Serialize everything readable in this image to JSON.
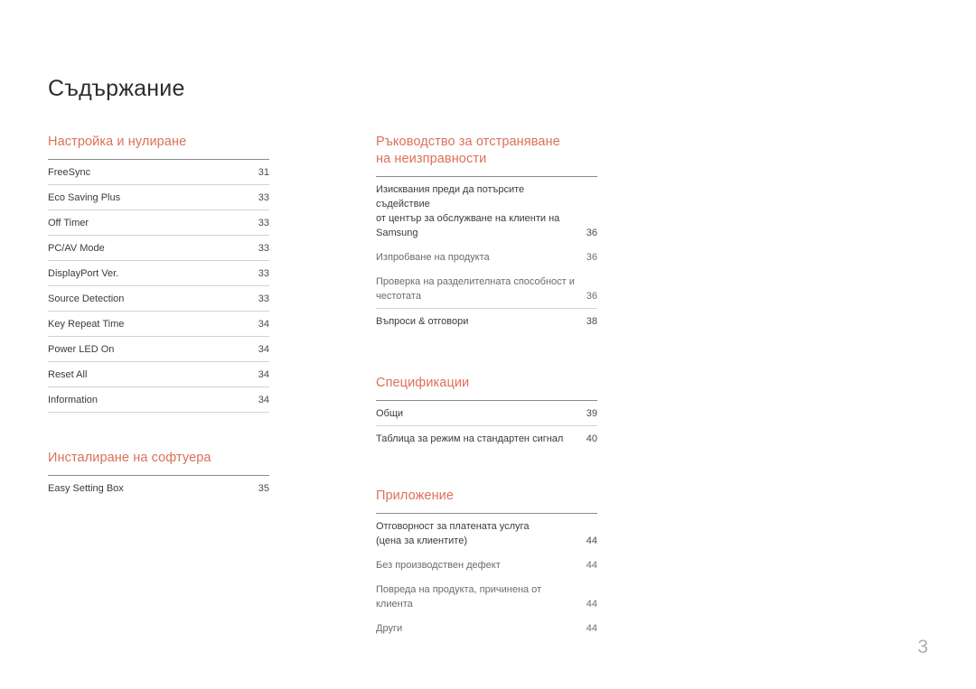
{
  "document": {
    "title": "Съдържание",
    "page_number": "3",
    "accent_color": "#dd7058"
  },
  "left_column": [
    {
      "heading": "Настройка и нулиране",
      "entries": [
        {
          "lines": [
            "FreeSync"
          ],
          "page": "31"
        },
        {
          "lines": [
            "Eco Saving Plus"
          ],
          "page": "33"
        },
        {
          "lines": [
            "Off Timer"
          ],
          "page": "33"
        },
        {
          "lines": [
            "PC/AV Mode"
          ],
          "page": "33"
        },
        {
          "lines": [
            "DisplayPort Ver."
          ],
          "page": "33"
        },
        {
          "lines": [
            "Source Detection"
          ],
          "page": "33"
        },
        {
          "lines": [
            "Key Repeat Time"
          ],
          "page": "34"
        },
        {
          "lines": [
            "Power LED On"
          ],
          "page": "34"
        },
        {
          "lines": [
            "Reset All"
          ],
          "page": "34"
        },
        {
          "lines": [
            "Information"
          ],
          "page": "34"
        }
      ]
    },
    {
      "heading": "Инсталиране на софтуера",
      "entries": [
        {
          "lines": [
            "Easy Setting Box"
          ],
          "page": "35"
        }
      ]
    }
  ],
  "right_column": [
    {
      "heading": "Ръководство за отстраняване на неизправности",
      "heading_lines": [
        "Ръководство за отстраняване",
        "на неизправности"
      ],
      "entries": [
        {
          "lines": [
            "Изисквания преди да потърсите съдействие",
            "от център за обслужване на клиенти на",
            "Samsung"
          ],
          "page": "36",
          "style": "primary"
        },
        {
          "lines": [
            "Изпробване на продукта"
          ],
          "page": "36",
          "style": "sub"
        },
        {
          "lines": [
            "Проверка на разделителната способност и",
            "честотата"
          ],
          "page": "36",
          "style": "sub"
        },
        {
          "lines": [
            "Въпроси & отговори"
          ],
          "page": "38",
          "style": "primary"
        }
      ]
    },
    {
      "heading": "Спецификации",
      "entries": [
        {
          "lines": [
            "Общи"
          ],
          "page": "39"
        },
        {
          "lines": [
            "Таблица за режим на стандартен сигнал"
          ],
          "page": "40"
        }
      ]
    },
    {
      "heading": "Приложение",
      "entries": [
        {
          "lines": [
            "Отговорност за платената услуга",
            "(цена за клиентите)"
          ],
          "page": "44",
          "style": "primary"
        },
        {
          "lines": [
            "Без производствен дефект"
          ],
          "page": "44",
          "style": "sub"
        },
        {
          "lines": [
            "Повреда на продукта, причинена от клиента"
          ],
          "page": "44",
          "style": "sub"
        },
        {
          "lines": [
            "Други"
          ],
          "page": "44",
          "style": "sub"
        }
      ]
    }
  ]
}
